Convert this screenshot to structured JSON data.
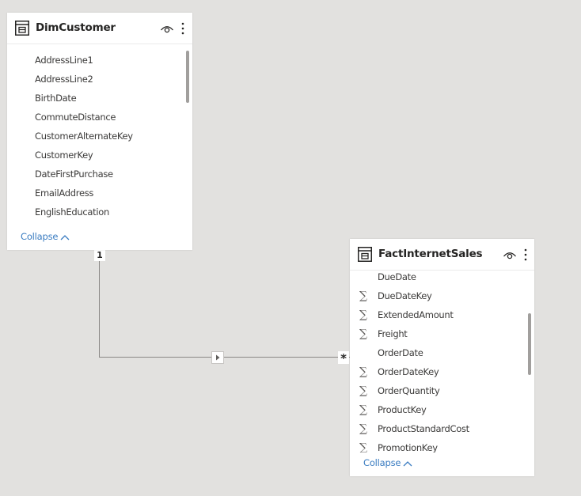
{
  "relationship": {
    "from_cardinality": "1",
    "to_cardinality": "*"
  },
  "tables": [
    {
      "name": "DimCustomer",
      "collapse_label": "Collapse",
      "fields": [
        {
          "label": "AddressLine1",
          "sigma": false
        },
        {
          "label": "AddressLine2",
          "sigma": false
        },
        {
          "label": "BirthDate",
          "sigma": false
        },
        {
          "label": "CommuteDistance",
          "sigma": false
        },
        {
          "label": "CustomerAlternateKey",
          "sigma": false
        },
        {
          "label": "CustomerKey",
          "sigma": false
        },
        {
          "label": "DateFirstPurchase",
          "sigma": false
        },
        {
          "label": "EmailAddress",
          "sigma": false
        },
        {
          "label": "EnglishEducation",
          "sigma": false
        }
      ]
    },
    {
      "name": "FactInternetSales",
      "collapse_label": "Collapse",
      "fields": [
        {
          "label": "DueDate",
          "sigma": false
        },
        {
          "label": "DueDateKey",
          "sigma": true
        },
        {
          "label": "ExtendedAmount",
          "sigma": true
        },
        {
          "label": "Freight",
          "sigma": true
        },
        {
          "label": "OrderDate",
          "sigma": false
        },
        {
          "label": "OrderDateKey",
          "sigma": true
        },
        {
          "label": "OrderQuantity",
          "sigma": true
        },
        {
          "label": "ProductKey",
          "sigma": true
        },
        {
          "label": "ProductStandardCost",
          "sigma": true
        },
        {
          "label": "PromotionKey",
          "sigma": true
        }
      ]
    }
  ],
  "symbols": {
    "sigma": "∑"
  },
  "icons": {
    "table": "table-icon",
    "visibility": "eye-icon",
    "more": "more-options-icon",
    "collapse": "chevron-up-icon",
    "filter_direction": "triangle-right-icon"
  },
  "colors": {
    "canvas": "#e2e1df",
    "link": "#3a7cc1",
    "line": "#8a8886"
  }
}
